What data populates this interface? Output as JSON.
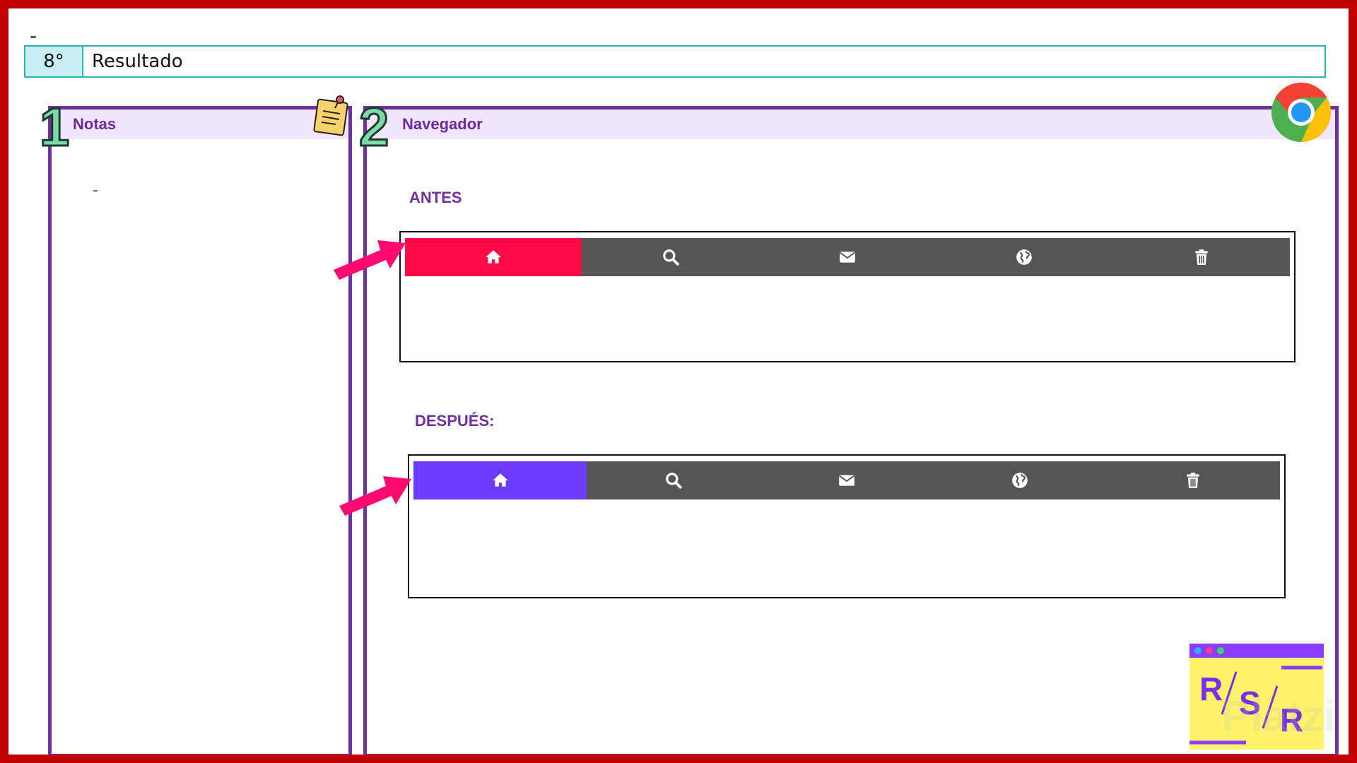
{
  "header": {
    "top_mark": "-",
    "step_number": "8°",
    "step_title": "Resultado"
  },
  "notes": {
    "number": "1",
    "title": "Notas",
    "body": "-"
  },
  "browser": {
    "number": "2",
    "title": "Navegador",
    "before_label": "ANTES",
    "after_label": "DESPUÉS:",
    "nav_icons": [
      "home-icon",
      "search-icon",
      "mail-icon",
      "globe-icon",
      "trash-icon"
    ]
  },
  "colors": {
    "frame_red": "#c00000",
    "panel_purple": "#7030a0",
    "step_teal": "#2ab3b8",
    "nav_gray": "#555555",
    "active_before": "#ff0a45",
    "active_after": "#6b3cff",
    "arrow_pink": "#ff0a6e"
  },
  "logo": {
    "text": "R/S/R"
  },
  "watermark": "Platzi"
}
